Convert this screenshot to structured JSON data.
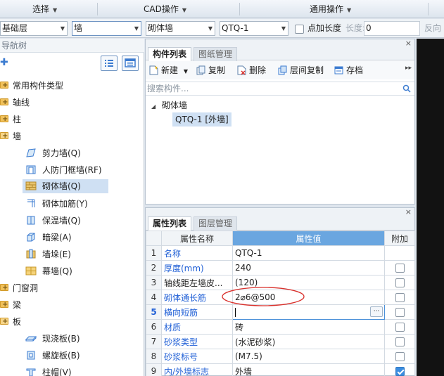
{
  "menubar": {
    "items": [
      {
        "label": "选择"
      },
      {
        "label": "CAD操作"
      },
      {
        "label": "通用操作"
      }
    ]
  },
  "toolbar": {
    "floor_value": "基础层",
    "category_value": "墙",
    "type_value": "砌体墙",
    "component_value": "QTQ-1",
    "point_length_label": "点加长度",
    "length_label": "长度:",
    "length_value": "0",
    "reverse_label": "反向"
  },
  "nav": {
    "title": "导航树",
    "items": [
      {
        "label": "常用构件类型"
      },
      {
        "label": "轴线"
      },
      {
        "label": "柱"
      },
      {
        "label": "墙"
      },
      {
        "label": "剪力墙(Q)"
      },
      {
        "label": "人防门框墙(RF)"
      },
      {
        "label": "砌体墙(Q)"
      },
      {
        "label": "砌体加筋(Y)"
      },
      {
        "label": "保温墙(Q)"
      },
      {
        "label": "暗梁(A)"
      },
      {
        "label": "墙垛(E)"
      },
      {
        "label": "幕墙(Q)"
      },
      {
        "label": "门窗洞"
      },
      {
        "label": "梁"
      },
      {
        "label": "板"
      },
      {
        "label": "现浇板(B)"
      },
      {
        "label": "螺旋板(B)"
      },
      {
        "label": "柱帽(V)"
      }
    ]
  },
  "component_panel": {
    "tabs": [
      {
        "label": "构件列表"
      },
      {
        "label": "图纸管理"
      }
    ],
    "tools": [
      {
        "label": "新建"
      },
      {
        "label": "复制"
      },
      {
        "label": "删除"
      },
      {
        "label": "层间复制"
      },
      {
        "label": "存档"
      }
    ],
    "search_placeholder": "搜索构件...",
    "tree_root": "砌体墙",
    "tree_child": "QTQ-1 [外墙]"
  },
  "properties_panel": {
    "tabs": [
      {
        "label": "属性列表"
      },
      {
        "label": "图层管理"
      }
    ],
    "headers": {
      "name": "属性名称",
      "value": "属性值",
      "extra": "附加"
    },
    "rows": [
      {
        "num": "1",
        "name": "名称",
        "value": "QTQ-1"
      },
      {
        "num": "2",
        "name": "厚度(mm)",
        "value": "240"
      },
      {
        "num": "3",
        "name": "轴线距左墙皮...",
        "value": "(120)"
      },
      {
        "num": "4",
        "name": "砌体通长筋",
        "value": "2⌀6@500"
      },
      {
        "num": "5",
        "name": "横向短筋",
        "value": ""
      },
      {
        "num": "6",
        "name": "材质",
        "value": "砖"
      },
      {
        "num": "7",
        "name": "砂浆类型",
        "value": "(水泥砂浆)"
      },
      {
        "num": "8",
        "name": "砂浆标号",
        "value": "(M7.5)"
      },
      {
        "num": "9",
        "name": "内/外墙标志",
        "value": "外墙"
      }
    ]
  },
  "colors": {
    "accent_blue": "#1f5fd6",
    "header_blue": "#6aa6e0",
    "annotation_red": "#d9302b"
  }
}
